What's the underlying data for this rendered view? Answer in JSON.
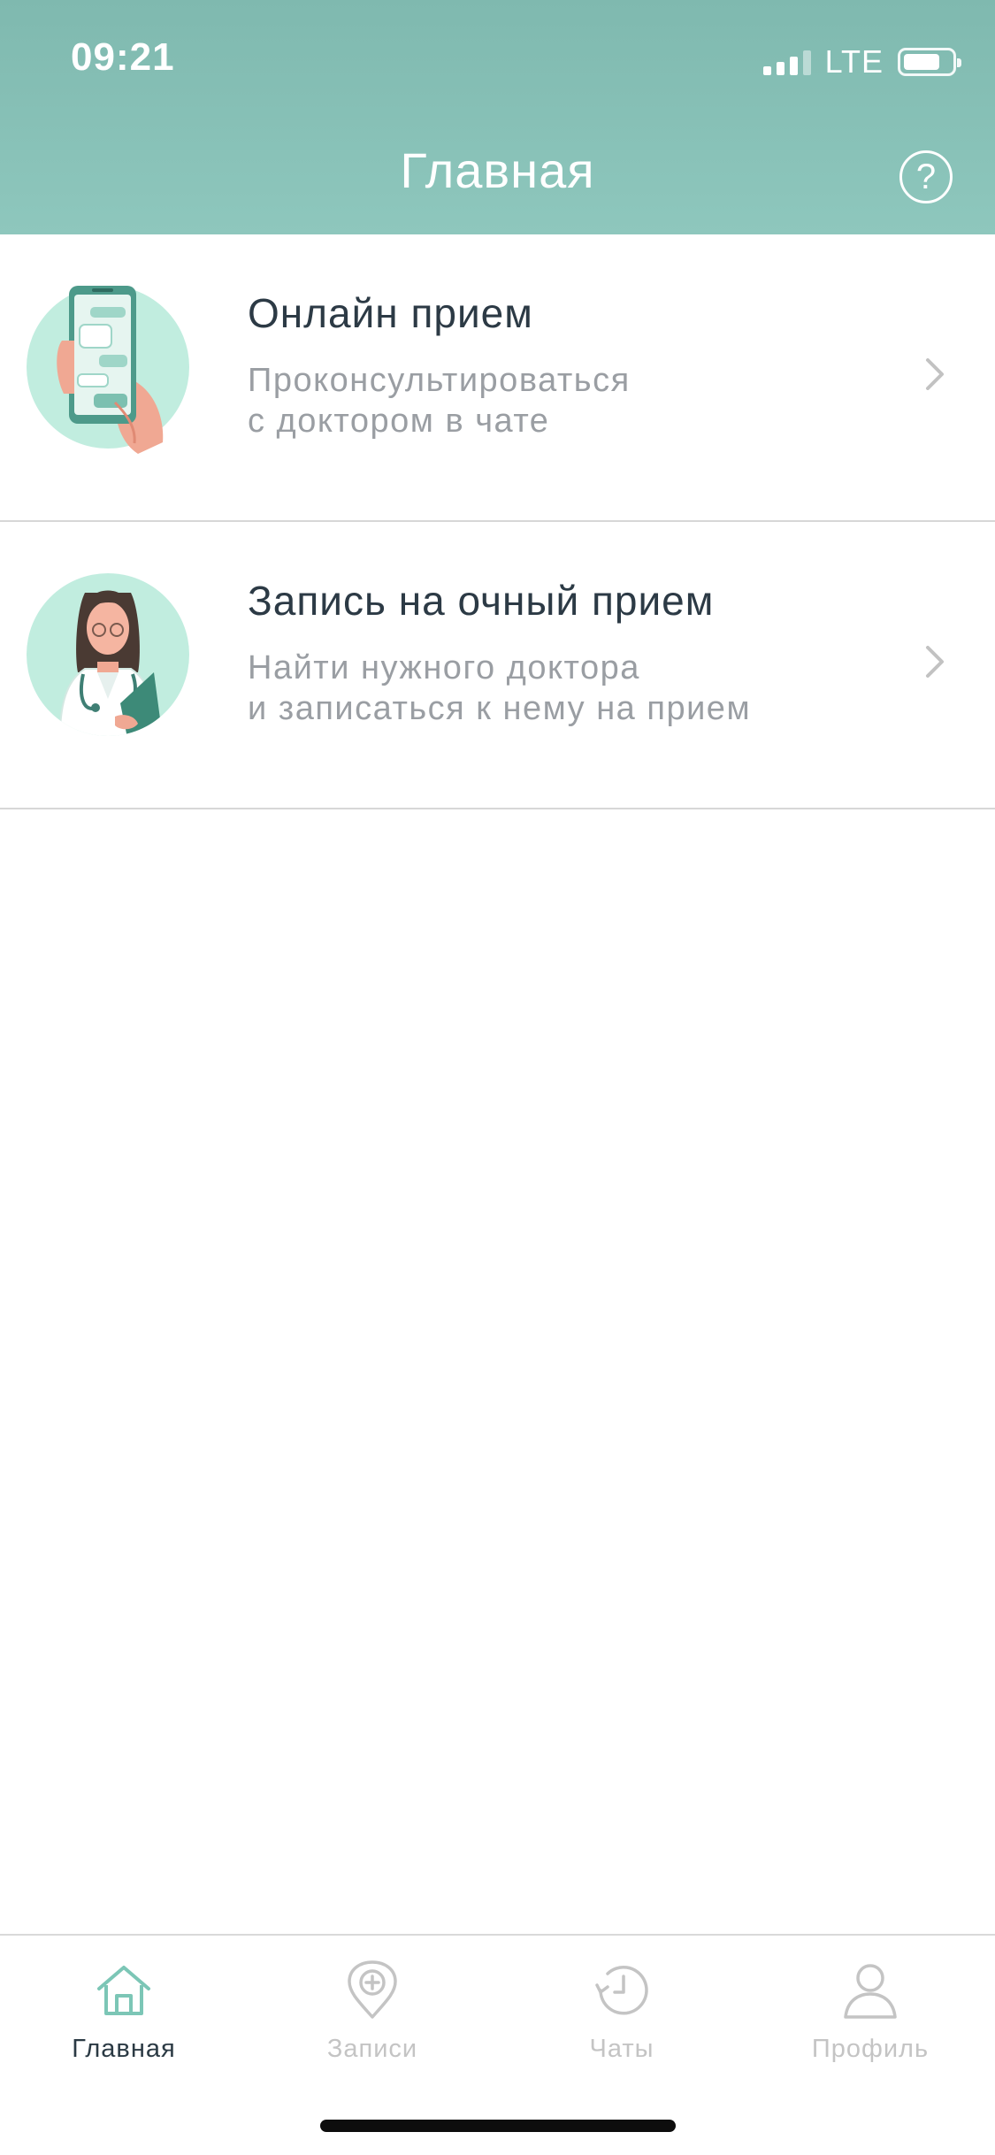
{
  "status_bar": {
    "time": "09:21",
    "network": "LTE"
  },
  "header": {
    "title": "Главная",
    "help_icon": "?"
  },
  "menu": [
    {
      "title": "Онлайн прием",
      "subtitle": "Проконсультироваться\nс доктором в чате",
      "icon": "phone-chat-illustration"
    },
    {
      "title": "Запись на очный прием",
      "subtitle": "Найти нужного доктора\nи записаться  к нему на прием",
      "icon": "doctor-illustration"
    }
  ],
  "tabs": [
    {
      "label": "Главная",
      "icon": "home-icon",
      "active": true
    },
    {
      "label": "Записи",
      "icon": "location-plus-icon",
      "active": false
    },
    {
      "label": "Чаты",
      "icon": "history-clock-icon",
      "active": false
    },
    {
      "label": "Профиль",
      "icon": "person-icon",
      "active": false
    }
  ],
  "colors": {
    "header": "#8ec7bd",
    "accent": "#7cc6b6",
    "illustration_bg": "#c1eddf",
    "text_primary": "#2b3a44",
    "text_secondary": "#9a9ea3",
    "tab_inactive": "#c4c4c4"
  }
}
